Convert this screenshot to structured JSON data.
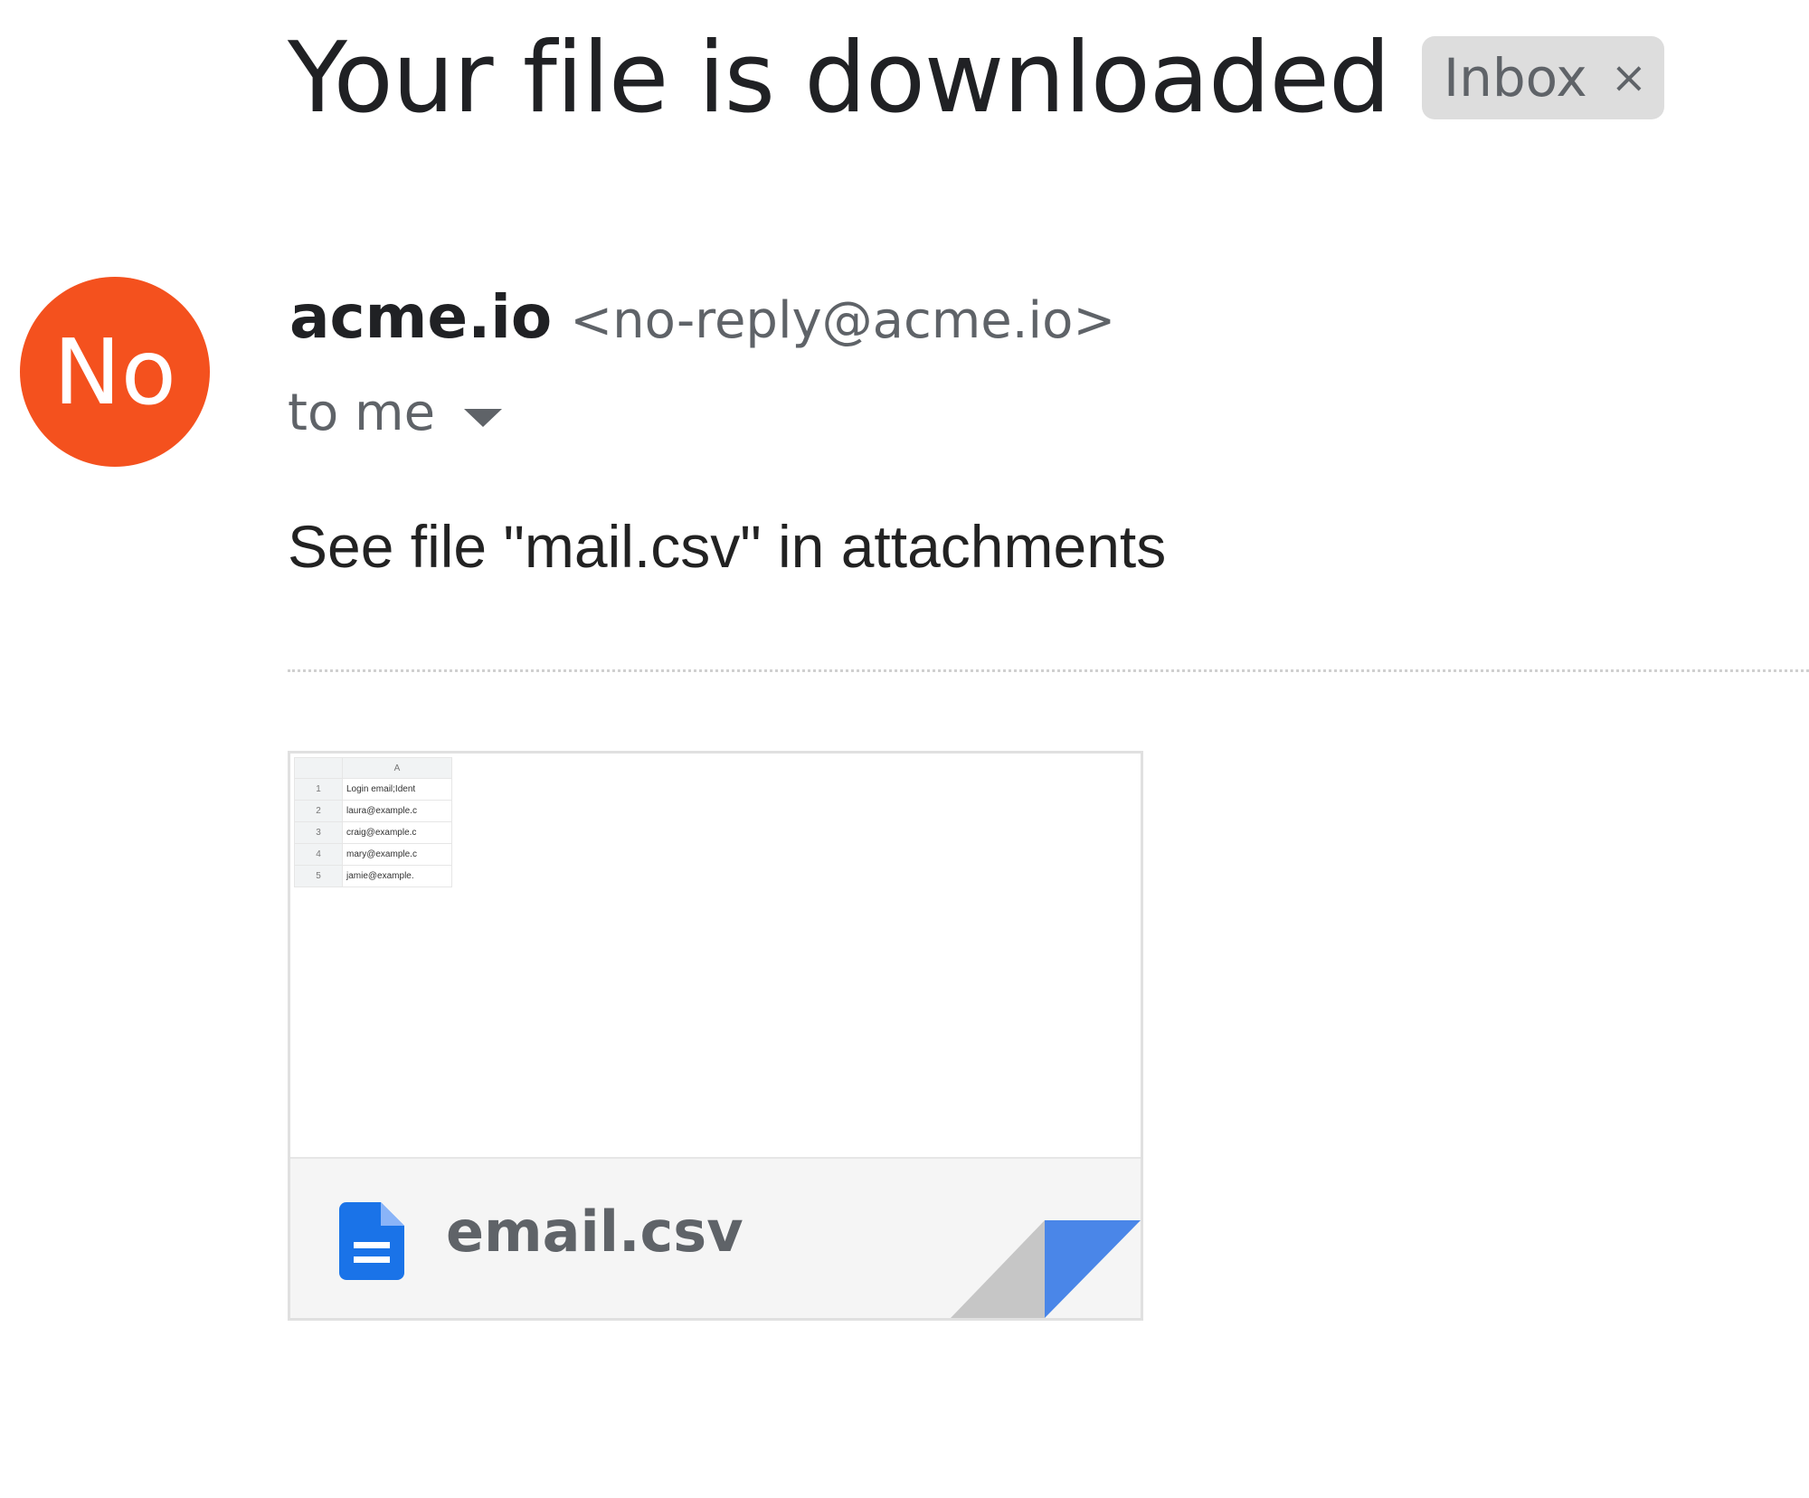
{
  "email": {
    "subject": "Your file is downloaded",
    "label": {
      "text": "Inbox",
      "remove_glyph": "×"
    },
    "sender": {
      "avatar_initials": "No",
      "avatar_color": "#f4511e",
      "name": "acme.io",
      "address": "<no-reply@acme.io>"
    },
    "recipient_text": "to me",
    "body": "See file \"mail.csv\" in attachments"
  },
  "attachment": {
    "file_name": "email.csv",
    "file_icon": "document-icon",
    "icon_color": "#1a73e8",
    "fold_color": "#4a86e8",
    "preview": {
      "column_header": "A",
      "rows": [
        {
          "num": "1",
          "value": "Login email;Ident"
        },
        {
          "num": "2",
          "value": "laura@example.c"
        },
        {
          "num": "3",
          "value": "craig@example.c"
        },
        {
          "num": "4",
          "value": "mary@example.c"
        },
        {
          "num": "5",
          "value": "jamie@example."
        }
      ]
    }
  }
}
